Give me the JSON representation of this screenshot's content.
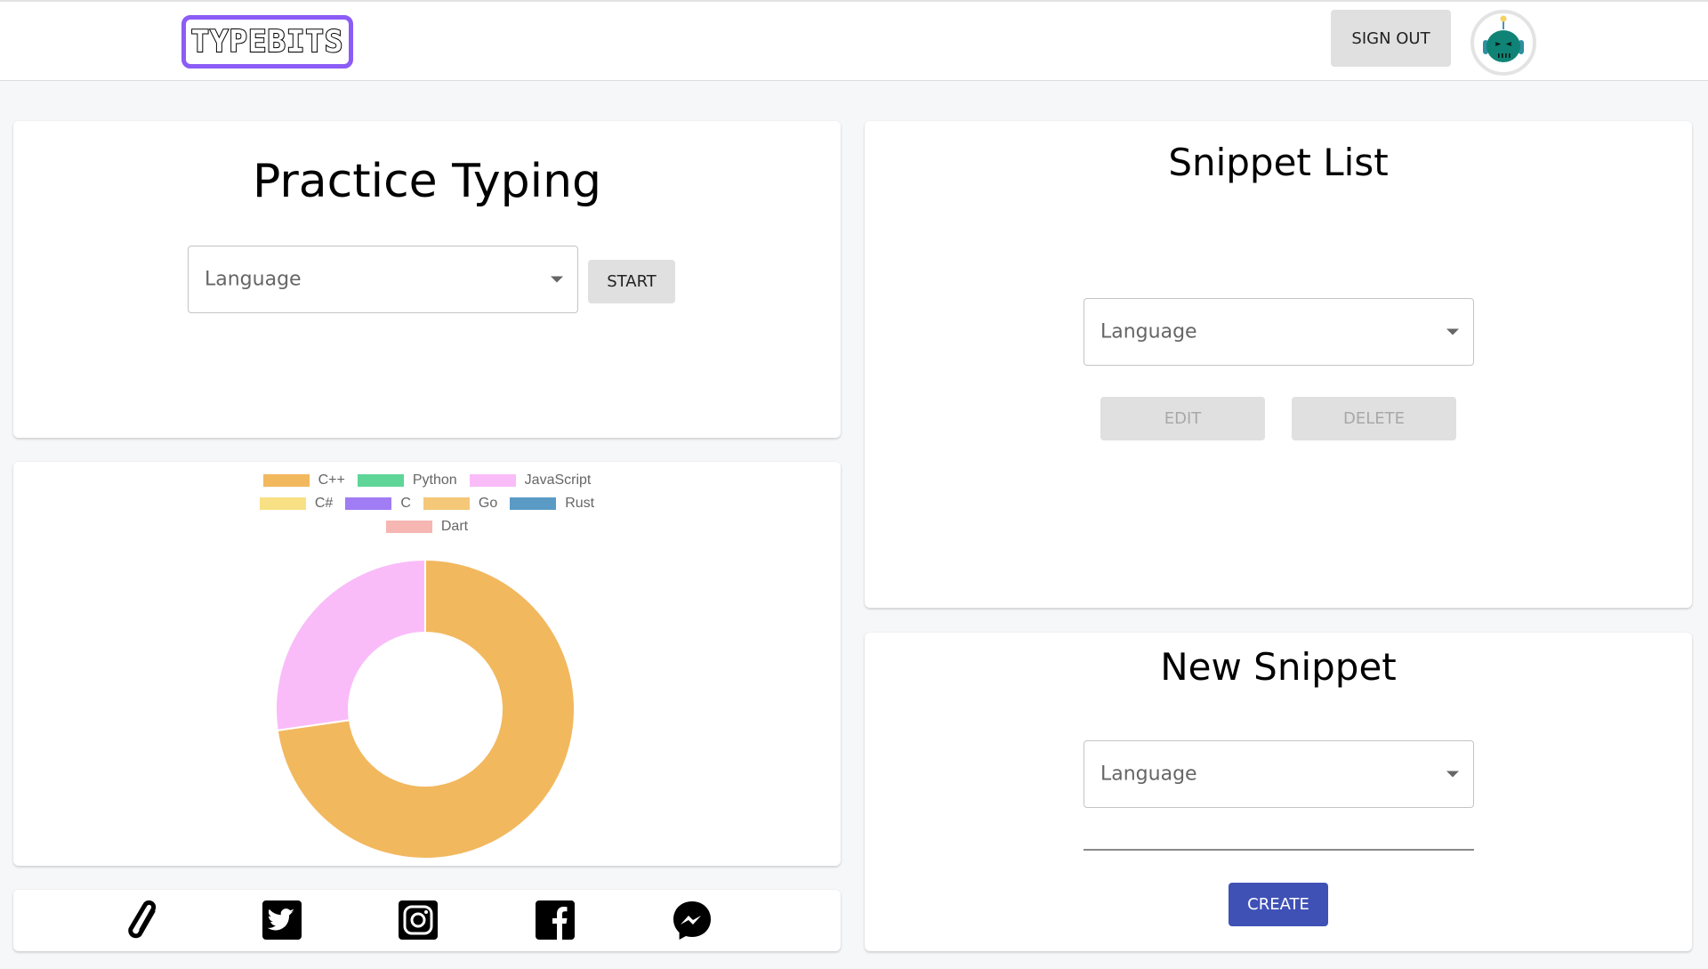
{
  "header": {
    "logo_text": "TYPEBITS",
    "logo_color": "#8b5cf6",
    "sign_out_label": "SIGN OUT",
    "avatar_icon": "robot-avatar-icon"
  },
  "practice": {
    "title": "Practice Typing",
    "language_placeholder": "Language",
    "start_label": "START"
  },
  "snippet_list": {
    "title": "Snippet List",
    "language_placeholder": "Language",
    "edit_label": "EDIT",
    "delete_label": "DELETE"
  },
  "new_snippet": {
    "title": "New Snippet",
    "language_placeholder": "Language",
    "name_value": "",
    "create_label": "CREATE",
    "accent": "#3f51b5"
  },
  "social": {
    "icons": [
      "paperclip-icon",
      "twitter-icon",
      "instagram-icon",
      "facebook-icon",
      "messenger-icon"
    ]
  },
  "chart_data": {
    "type": "pie",
    "variant": "doughnut",
    "title": "",
    "legend_position": "top",
    "categories": [
      "C++",
      "Python",
      "JavaScript",
      "C#",
      "C",
      "Go",
      "Rust",
      "Dart"
    ],
    "values": [
      8,
      0,
      3,
      0,
      0,
      0,
      0,
      0
    ],
    "colors": [
      "#f2b85e",
      "#5fd598",
      "#f9bcf9",
      "#f8e084",
      "#a07cf5",
      "#f4c878",
      "#5a9bc6",
      "#f6b6b2"
    ],
    "legend_rows": [
      [
        "C++",
        "Python",
        "JavaScript"
      ],
      [
        "C#",
        "C",
        "Go",
        "Rust"
      ],
      [
        "Dart"
      ]
    ]
  }
}
